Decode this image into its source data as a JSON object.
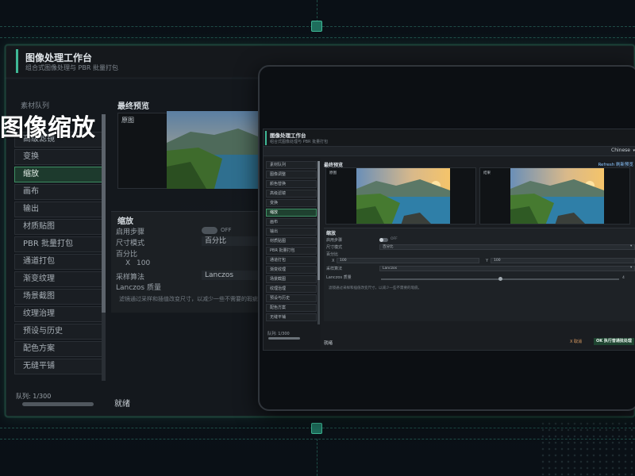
{
  "app": {
    "title": "图像处理工作台",
    "subtitle": "组合式图像处理与 PBR 批量打包"
  },
  "overlay": {
    "heading": "图像缩放"
  },
  "language": {
    "selected": "Chinese"
  },
  "sidebar": {
    "items": [
      {
        "label": "素材队列"
      },
      {
        "label": "图像调整"
      },
      {
        "label": "颜色替换"
      },
      {
        "label": "高级滤镜"
      },
      {
        "label": "变换"
      },
      {
        "label": "缩放",
        "active": true
      },
      {
        "label": "画布"
      },
      {
        "label": "输出"
      },
      {
        "label": "材质贴图"
      },
      {
        "label": "PBR 批量打包"
      },
      {
        "label": "通道打包"
      },
      {
        "label": "渐变纹理"
      },
      {
        "label": "场景截图"
      },
      {
        "label": "纹理治理"
      },
      {
        "label": "预设与历史"
      },
      {
        "label": "配色方案"
      },
      {
        "label": "无缝平铺"
      }
    ],
    "queue_count": "队列: 1/300"
  },
  "preview": {
    "title": "最终预览",
    "refresh_label": "Refresh 刷新预览",
    "original_label": "原图",
    "result_label": "结果"
  },
  "scale": {
    "title": "缩放",
    "enable_label": "启用步骤",
    "enable_state": "OFF",
    "size_mode_label": "尺寸模式",
    "size_mode_value": "百分比",
    "percent_label": "百分比",
    "x_label": "X",
    "x_value": "100",
    "y_label": "Y",
    "y_value": "100",
    "resample_label": "采样算法",
    "resample_value": "Lanczos",
    "quality_label": "Lanczos 质量",
    "quality_value": "4",
    "quality_level": 0.5,
    "hint": "滤镜通过采样和插值改变尺寸，以减少一些不需要的瑕疵。"
  },
  "status": {
    "text": "就绪",
    "cancel_label": "X 取消",
    "ok_label": "OK 执行普通批处理"
  }
}
